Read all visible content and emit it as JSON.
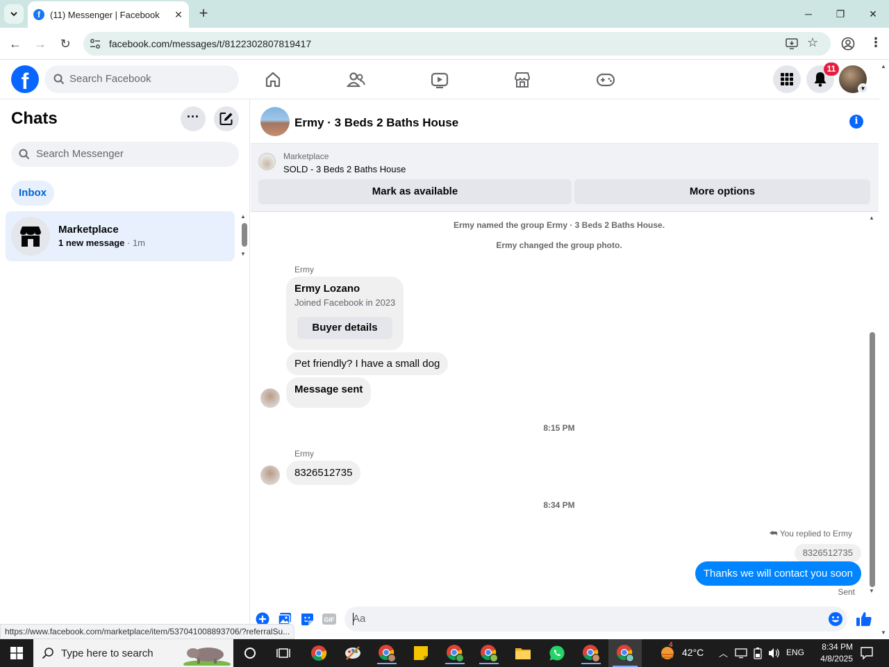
{
  "browser": {
    "tab_title": "(11) Messenger | Facebook",
    "url": "facebook.com/messages/t/8122302807819417",
    "status_url": "https://www.facebook.com/marketplace/item/537041008893706/?referralSu..."
  },
  "header": {
    "search_placeholder": "Search Facebook",
    "notification_count": "11"
  },
  "sidebar": {
    "title": "Chats",
    "search_placeholder": "Search Messenger",
    "filter": "Inbox",
    "chats": [
      {
        "name": "Marketplace",
        "subtitle": "1 new message",
        "time": " · 1m"
      }
    ]
  },
  "conversation": {
    "title": "Ermy · 3 Beds 2 Baths House",
    "banner": {
      "label": "Marketplace",
      "listing": "SOLD - 3 Beds 2 Baths House",
      "primary_button": "Mark as available",
      "secondary_button": "More options"
    },
    "system_messages": [
      "Ermy named the group Ermy · 3 Beds 2 Baths House.",
      "Ermy changed the group photo."
    ],
    "sender_name": "Ermy",
    "buyer_card": {
      "name": "Ermy Lozano",
      "joined": "Joined Facebook in 2023",
      "button": "Buyer details"
    },
    "messages": [
      "Pet friendly? I have a small dog",
      "Message sent",
      "8326512735"
    ],
    "time_separators": [
      "8:15 PM",
      "8:34 PM"
    ],
    "reply": {
      "context": "You replied to Ermy",
      "quoted": "8326512735",
      "text": "Thanks we will contact you soon",
      "status": "Sent"
    },
    "composer_placeholder": "Aa"
  },
  "taskbar": {
    "search_placeholder": "Type here to search",
    "weather": "42°C",
    "weather_badge": "4",
    "language": "ENG",
    "time": "8:34 PM",
    "date": "4/8/2025"
  },
  "colors": {
    "facebook_blue": "#0866ff",
    "messenger_bubble": "#0084ff",
    "badge_red": "#e41e3f"
  }
}
